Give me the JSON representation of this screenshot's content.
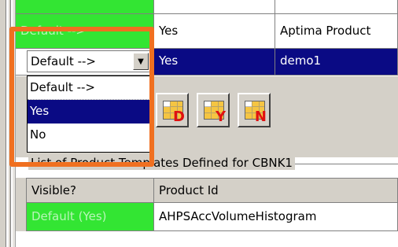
{
  "upper_grid": {
    "row_partial": {
      "c2": "",
      "c3": ""
    },
    "row_default": {
      "c1": "Default -->",
      "c2": "Yes",
      "c3": "Aptima Product"
    },
    "row_selected": {
      "c2": "Yes",
      "c3": "demo1"
    }
  },
  "combo": {
    "value": "Default -->"
  },
  "dropdown": {
    "options": [
      "Default -->",
      "Yes",
      "No"
    ],
    "selected": "Yes"
  },
  "toolbar": {
    "buttons": [
      {
        "letter": "D",
        "icon": "grid-default-icon"
      },
      {
        "letter": "Y",
        "icon": "grid-yes-icon"
      },
      {
        "letter": "N",
        "icon": "grid-no-icon"
      }
    ]
  },
  "group": {
    "title": "List of Product Templates Defined for CBNK1"
  },
  "lower_grid": {
    "headers": [
      "Visible?",
      "Product Id"
    ],
    "rows": [
      {
        "visible": "Default (Yes)",
        "product_id": "AHPSAccVolumeHistogram"
      }
    ]
  },
  "colors": {
    "green_cell": "#33e533",
    "selected_row": "#0a0a84",
    "highlight": "#f07020",
    "panel": "#d4d0c8"
  }
}
